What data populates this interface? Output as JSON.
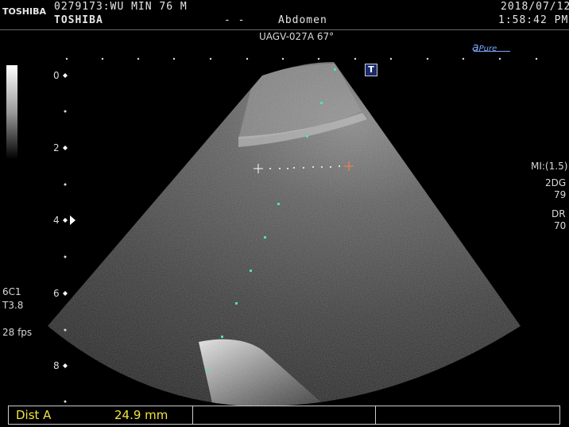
{
  "header": {
    "brand": "TOSHIBA",
    "patient_line": "0279173:WU MIN    76  M",
    "manufacturer": "TOSHIBA",
    "placeholder_dashes": "- -",
    "preset": "Abdomen",
    "date": "2018/07/12",
    "time": "1:58:42 PM",
    "probe_info": "UAGV-027A 67°"
  },
  "logos": {
    "apure": "Pure"
  },
  "right_panel": {
    "mi": "MI:(1.5)",
    "mode": "2DG",
    "gain": "79",
    "dr_label": "DR",
    "dr_value": "70"
  },
  "left_panel": {
    "probe": "6C1",
    "thermal": "T3.8",
    "frame_rate": "28 fps"
  },
  "depth_scale": {
    "labels": [
      "0",
      "2",
      "4",
      "6",
      "8"
    ]
  },
  "icons": {
    "top_marker": "T"
  },
  "measurement": {
    "label": "Dist  A",
    "value": "24.9  mm",
    "caliper_color": "#ff8040"
  }
}
